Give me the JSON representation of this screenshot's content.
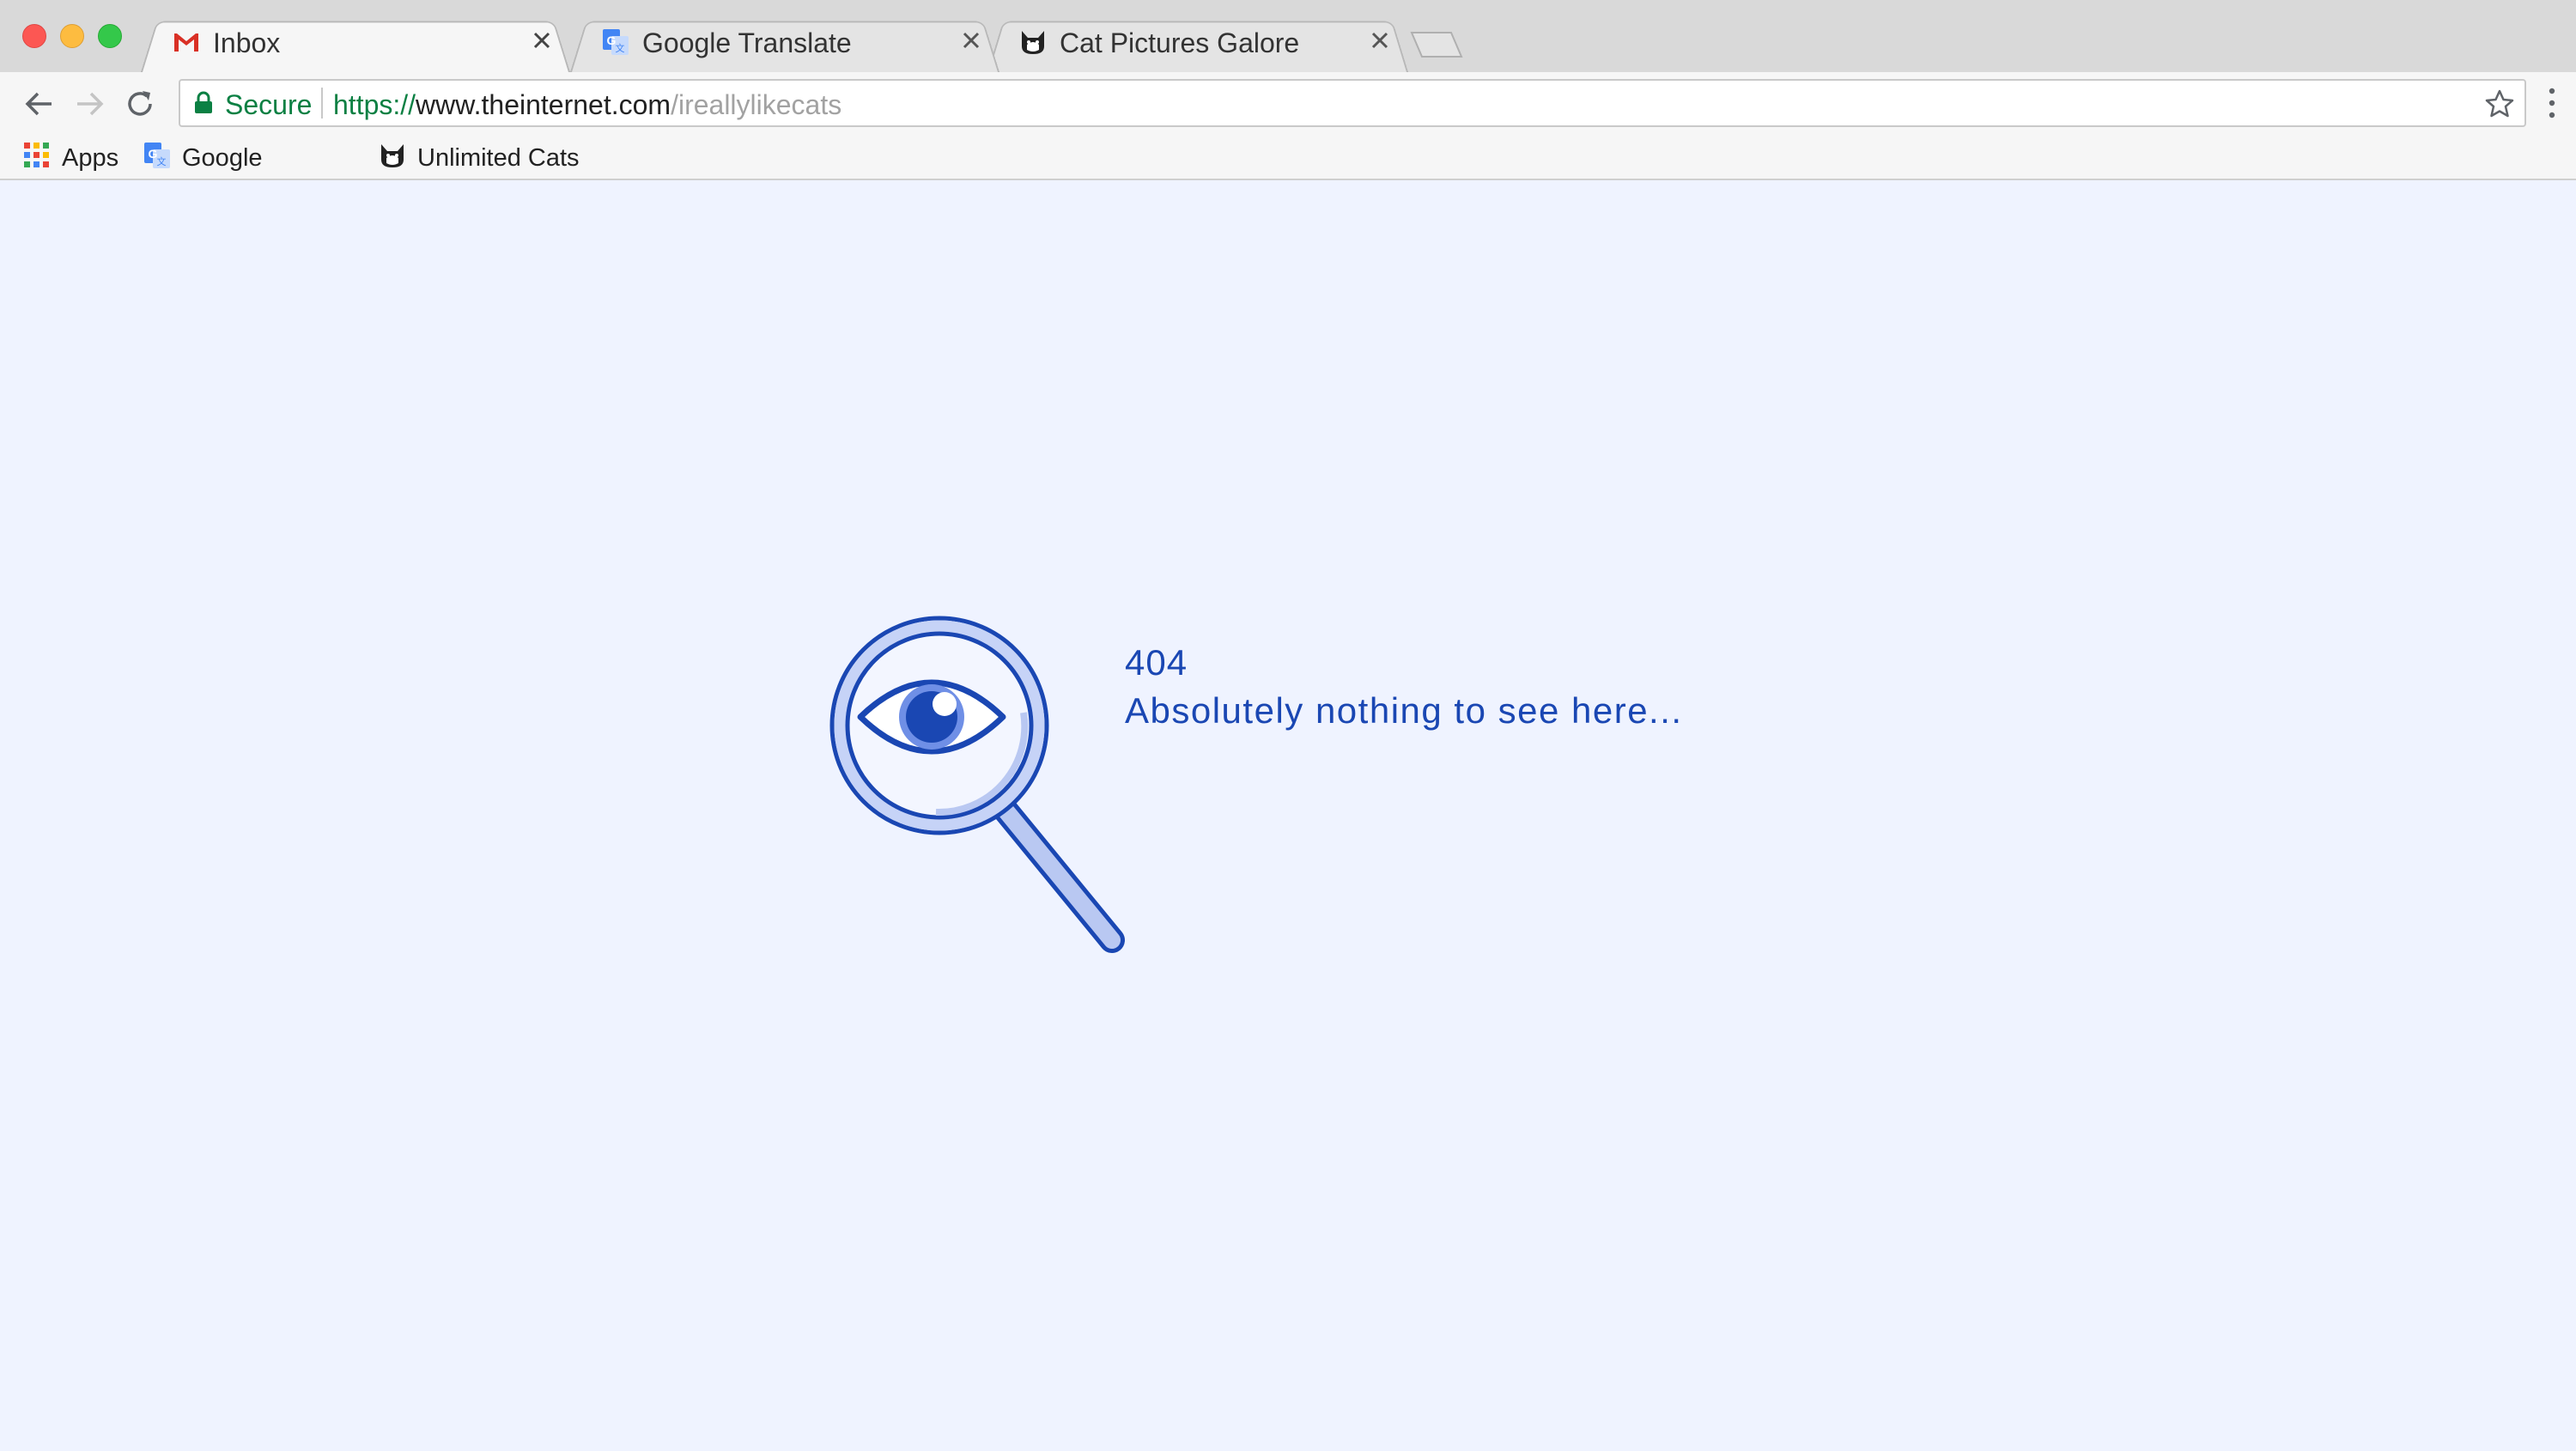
{
  "tabs": [
    {
      "title": "Inbox",
      "icon": "gmail-icon",
      "active": true
    },
    {
      "title": "Google Translate",
      "icon": "google-translate-icon",
      "active": false
    },
    {
      "title": "Cat Pictures Galore",
      "icon": "cat-icon",
      "active": false
    }
  ],
  "omnibox": {
    "security_label": "Secure",
    "url_scheme": "https://",
    "url_host": "www.theinternet.com",
    "url_path": "/ireallylikecats"
  },
  "bookmarks": [
    {
      "label": "Apps",
      "icon": "apps-grid-icon"
    },
    {
      "label": "Google",
      "icon": "google-translate-icon"
    },
    {
      "label": "Unlimited Cats",
      "icon": "cat-icon"
    }
  ],
  "error_page": {
    "code": "404",
    "message": "Absolutely nothing to see here..."
  },
  "colors": {
    "page_background": "#eff3ff",
    "error_text": "#1a47b3",
    "secure_green": "#0b8043"
  }
}
